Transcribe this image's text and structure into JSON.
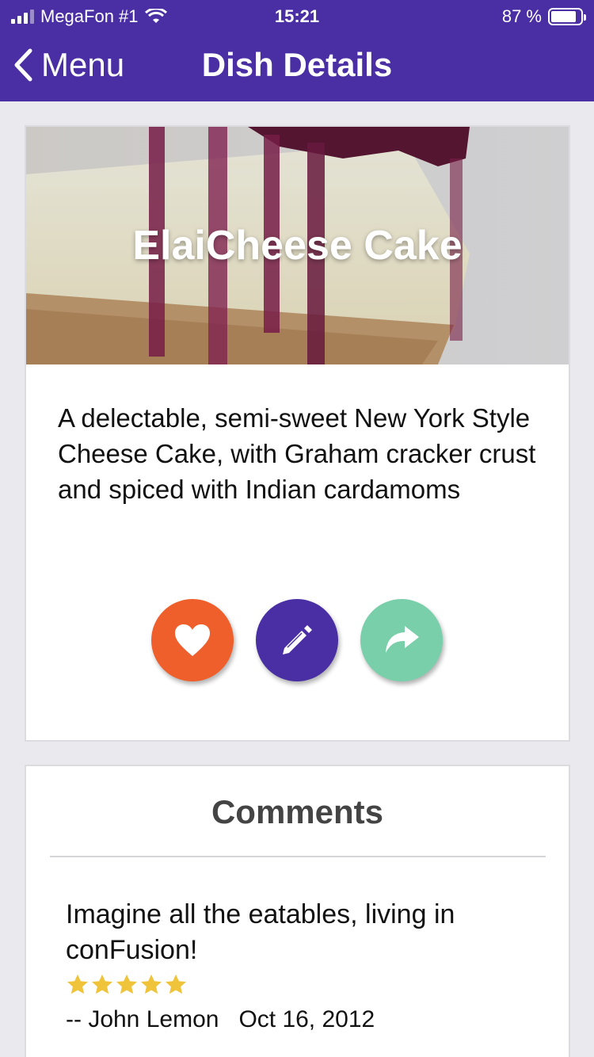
{
  "status_bar": {
    "carrier": "MegaFon #1",
    "time": "15:21",
    "battery": "87 %",
    "battery_level": 0.87
  },
  "header": {
    "back_label": "Menu",
    "title": "Dish Details",
    "background_color": "#4a2ea3"
  },
  "dish": {
    "name": "ElaiCheese Cake",
    "description": "A delectable, semi-sweet New York Style Cheese Cake, with Graham cracker crust and spiced with Indian cardamoms"
  },
  "actions": [
    {
      "name": "favorite",
      "icon": "heart-icon",
      "color": "#ee5f2b"
    },
    {
      "name": "edit",
      "icon": "pencil-icon",
      "color": "#4a2ea3"
    },
    {
      "name": "share",
      "icon": "share-icon",
      "color": "#78cfaa"
    }
  ],
  "comments": {
    "title": "Comments",
    "items": [
      {
        "text": "Imagine all the eatables, living in conFusion!",
        "rating": 5,
        "meta": "-- John Lemon   Oct 16, 2012"
      }
    ]
  },
  "colors": {
    "star": "#f0c43a",
    "page_background": "#e9e9ee"
  }
}
